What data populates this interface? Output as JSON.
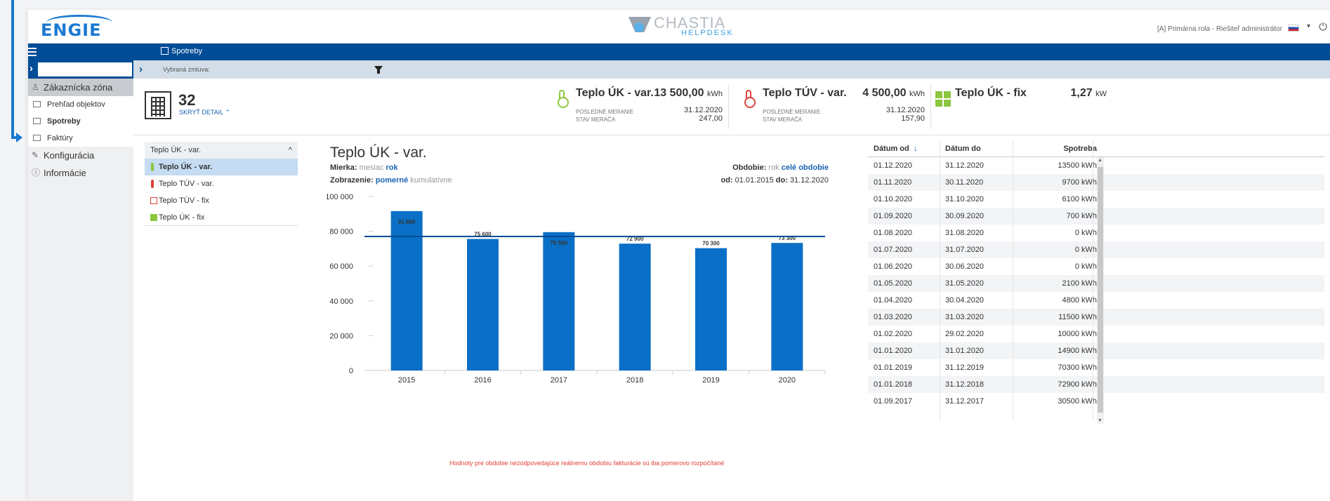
{
  "header": {
    "logo_text": "ENGIE",
    "helpdesk_title": "CHASTIA",
    "helpdesk_sub": "HELPDESK",
    "role_text": "[A] Primárna rola - Riešiteľ administrátor"
  },
  "navbar": {
    "title": "Spotreby"
  },
  "filter": {
    "label": "Vybraná zmluva:",
    "search_value": ""
  },
  "sidebar": {
    "sections": [
      {
        "label": "Zákaznícka zóna"
      },
      {
        "label": "Konfigurácia"
      },
      {
        "label": "Informácie"
      }
    ],
    "items": [
      {
        "label": "Prehľad objektov"
      },
      {
        "label": "Spotreby"
      },
      {
        "label": "Faktúry"
      }
    ]
  },
  "object": {
    "number": "32",
    "hide_label": "SKRYŤ DETAIL"
  },
  "cards": [
    {
      "name": "Teplo ÚK - var.",
      "value": "13 500,00",
      "unit": "kWh",
      "k1": "POSLEDNÉ MERANIE",
      "k2": "STAV MERAČA",
      "v1": "31.12.2020",
      "v2": "247,00"
    },
    {
      "name": "Teplo TÚV - var.",
      "value": "4 500,00",
      "unit": "kWh",
      "k1": "POSLEDNÉ MERANIE",
      "k2": "STAV MERAČA",
      "v1": "31.12.2020",
      "v2": "157,90"
    },
    {
      "name": "Teplo ÚK - fix",
      "value": "1,27",
      "unit": "kW"
    }
  ],
  "sublist": {
    "header": "Teplo ÚK - var.",
    "items": [
      "Teplo ÚK - var.",
      "Teplo TÚV - var.",
      "Teplo TÚV - fix",
      "Teplo ÚK - fix"
    ]
  },
  "chart_panel": {
    "title": "Teplo ÚK - var.",
    "mierka_label": "Mierka:",
    "mierka_opt1": "mesiac",
    "mierka_opt2": "rok",
    "zobr_label": "Zobrazenie:",
    "zobr_opt1": "pomerné",
    "zobr_opt2": "kumulatívne",
    "obdobie_label": "Obdobie:",
    "obdobie_opt1": "rok",
    "obdobie_opt2": "celé obdobie",
    "od_label": "od:",
    "od_value": "01.01.2015",
    "do_label": "do:",
    "do_value": "31.12.2020",
    "note": "Hodnoty pre obdobie nezodpovedajúce reálnemu obdobiu fakturácie sú iba pomerovo rozpočítané"
  },
  "chart_data": {
    "type": "bar",
    "categories": [
      "2015",
      "2016",
      "2017",
      "2018",
      "2019",
      "2020"
    ],
    "values": [
      91600,
      75600,
      79500,
      72900,
      70300,
      73300
    ],
    "data_labels": [
      "91 600",
      "75 600",
      "79 500",
      "72 900",
      "70 300",
      "73 300"
    ],
    "reference_line": 77000,
    "ylim": [
      0,
      100000
    ],
    "yticks": [
      0,
      20000,
      40000,
      60000,
      80000,
      100000
    ],
    "ytick_labels": [
      "0",
      "20 000",
      "40 000",
      "60 000",
      "80 000",
      "100 000"
    ],
    "bar_color": "#0a6fc6",
    "line_color": "#004c97"
  },
  "table": {
    "headers": [
      "Dátum od",
      "Dátum do",
      "Spotreba"
    ],
    "rows": [
      [
        "01.12.2020",
        "31.12.2020",
        "13500 kWh"
      ],
      [
        "01.11.2020",
        "30.11.2020",
        "9700 kWh"
      ],
      [
        "01.10.2020",
        "31.10.2020",
        "6100 kWh"
      ],
      [
        "01.09.2020",
        "30.09.2020",
        "700 kWh"
      ],
      [
        "01.08.2020",
        "31.08.2020",
        "0 kWh"
      ],
      [
        "01.07.2020",
        "31.07.2020",
        "0 kWh"
      ],
      [
        "01.06.2020",
        "30.06.2020",
        "0 kWh"
      ],
      [
        "01.05.2020",
        "31.05.2020",
        "2100 kWh"
      ],
      [
        "01.04.2020",
        "30.04.2020",
        "4800 kWh"
      ],
      [
        "01.03.2020",
        "31.03.2020",
        "11500 kWh"
      ],
      [
        "01.02.2020",
        "29.02.2020",
        "10000 kWh"
      ],
      [
        "01.01.2020",
        "31.01.2020",
        "14900 kWh"
      ],
      [
        "01.01.2019",
        "31.12.2019",
        "70300 kWh"
      ],
      [
        "01.01.2018",
        "31.12.2018",
        "72900 kWh"
      ],
      [
        "01.09.2017",
        "31.12.2017",
        "30500 kWh"
      ]
    ]
  },
  "colors": {
    "brand": "#004c97",
    "accent": "#1c7ad1",
    "green": "#8cc63f",
    "red": "#e0413a"
  }
}
